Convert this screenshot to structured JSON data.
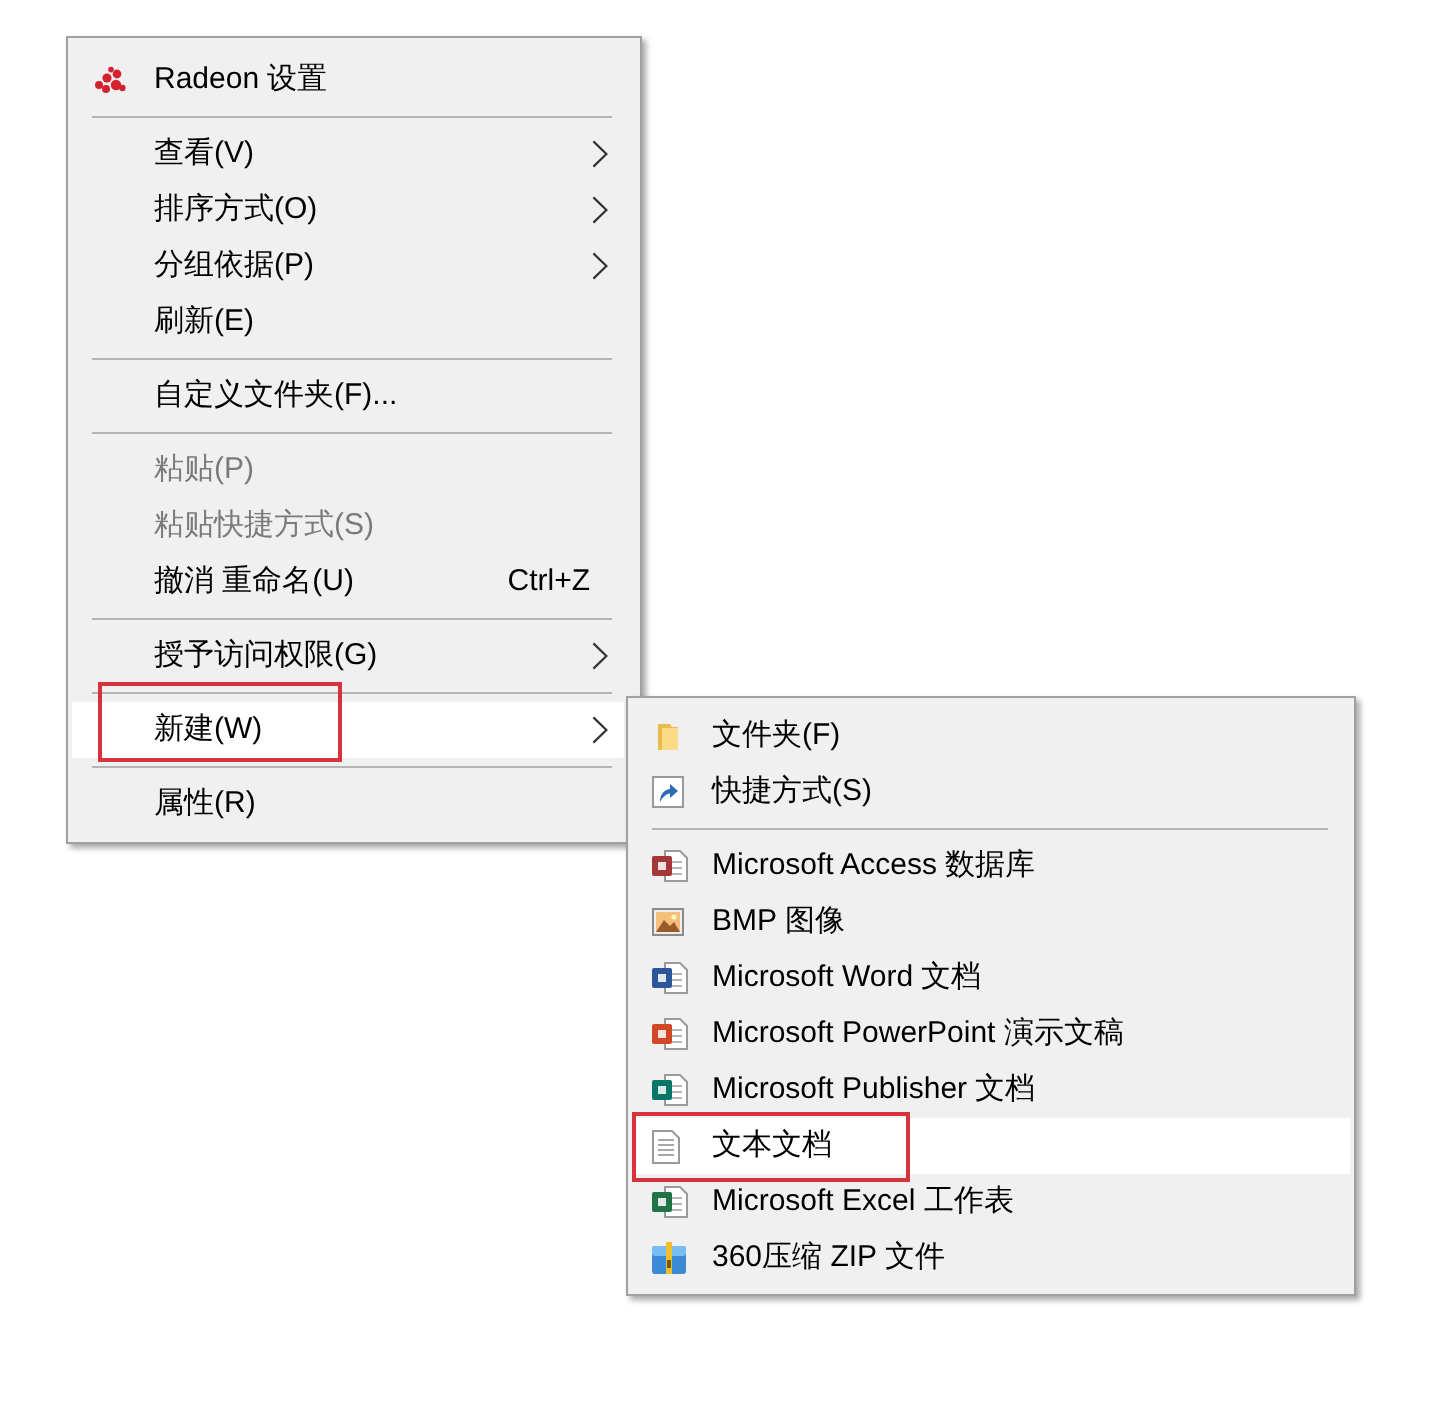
{
  "context_menu": {
    "items": [
      {
        "kind": "item",
        "label": "Radeon 设置",
        "icon": true,
        "submenu": false,
        "disabled": false,
        "selected": false,
        "annotated": false
      },
      {
        "kind": "separator"
      },
      {
        "kind": "item",
        "label": "查看(V)",
        "icon": false,
        "submenu": true,
        "disabled": false,
        "selected": false,
        "annotated": false
      },
      {
        "kind": "item",
        "label": "排序方式(O)",
        "icon": false,
        "submenu": true,
        "disabled": false,
        "selected": false,
        "annotated": false
      },
      {
        "kind": "item",
        "label": "分组依据(P)",
        "icon": false,
        "submenu": true,
        "disabled": false,
        "selected": false,
        "annotated": false
      },
      {
        "kind": "item",
        "label": "刷新(E)",
        "icon": false,
        "submenu": false,
        "disabled": false,
        "selected": false,
        "annotated": false
      },
      {
        "kind": "separator"
      },
      {
        "kind": "item",
        "label": "自定义文件夹(F)...",
        "icon": false,
        "submenu": false,
        "disabled": false,
        "selected": false,
        "annotated": false
      },
      {
        "kind": "separator"
      },
      {
        "kind": "item",
        "label": "粘贴(P)",
        "icon": false,
        "submenu": false,
        "disabled": true,
        "selected": false,
        "annotated": false
      },
      {
        "kind": "item",
        "label": "粘贴快捷方式(S)",
        "icon": false,
        "submenu": false,
        "disabled": true,
        "selected": false,
        "annotated": false
      },
      {
        "kind": "item",
        "label": "撤消 重命名(U)",
        "shortcut": "Ctrl+Z",
        "icon": false,
        "submenu": false,
        "disabled": false,
        "selected": false,
        "annotated": false
      },
      {
        "kind": "separator"
      },
      {
        "kind": "item",
        "label": "授予访问权限(G)",
        "icon": false,
        "submenu": true,
        "disabled": false,
        "selected": false,
        "annotated": false
      },
      {
        "kind": "separator"
      },
      {
        "kind": "item",
        "label": "新建(W)",
        "icon": false,
        "submenu": true,
        "disabled": false,
        "selected": true,
        "annotated": true
      },
      {
        "kind": "separator"
      },
      {
        "kind": "item",
        "label": "属性(R)",
        "icon": false,
        "submenu": false,
        "disabled": false,
        "selected": false,
        "annotated": false
      }
    ]
  },
  "new_submenu": {
    "items": [
      {
        "kind": "item",
        "label": "文件夹(F)",
        "icon": true,
        "selected": false,
        "annotated": false
      },
      {
        "kind": "item",
        "label": "快捷方式(S)",
        "icon": true,
        "selected": false,
        "annotated": false
      },
      {
        "kind": "separator"
      },
      {
        "kind": "item",
        "label": "Microsoft Access 数据库",
        "icon": true,
        "selected": false,
        "annotated": false
      },
      {
        "kind": "item",
        "label": "BMP 图像",
        "icon": true,
        "selected": false,
        "annotated": false
      },
      {
        "kind": "item",
        "label": "Microsoft Word 文档",
        "icon": true,
        "selected": false,
        "annotated": false
      },
      {
        "kind": "item",
        "label": "Microsoft PowerPoint 演示文稿",
        "icon": true,
        "selected": false,
        "annotated": false
      },
      {
        "kind": "item",
        "label": "Microsoft Publisher 文档",
        "icon": true,
        "selected": false,
        "annotated": false
      },
      {
        "kind": "item",
        "label": "文本文档",
        "icon": true,
        "selected": true,
        "annotated": true
      },
      {
        "kind": "item",
        "label": "Microsoft Excel 工作表",
        "icon": true,
        "selected": false,
        "annotated": false
      },
      {
        "kind": "item",
        "label": "360压缩 ZIP 文件",
        "icon": true,
        "selected": false,
        "annotated": false
      }
    ]
  }
}
